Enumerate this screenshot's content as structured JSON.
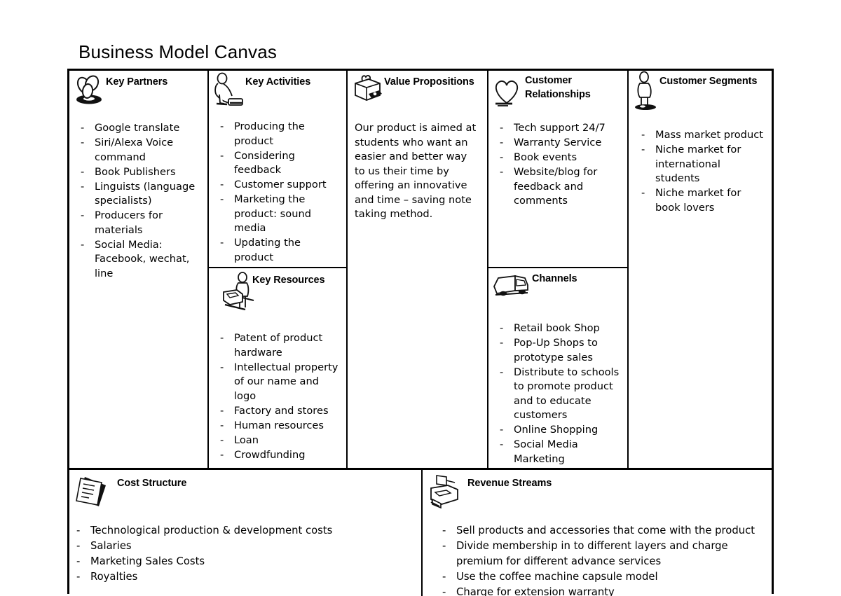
{
  "page": {
    "title": "Business Model Canvas"
  },
  "blocks": {
    "key_partners": {
      "title": "Key Partners",
      "icon": "interlocking-rings-icon",
      "items": [
        "Google translate",
        "Siri/Alexa Voice command",
        "Book Publishers",
        "Linguists (language specialists)",
        "Producers for materials",
        "Social Media: Facebook, wechat, line"
      ]
    },
    "key_activities": {
      "title": "Key Activities",
      "icon": "worker-person-icon",
      "items": [
        "Producing the product",
        "Considering feedback",
        "Customer support",
        "Marketing the product: sound media",
        "Updating the product"
      ]
    },
    "key_resources": {
      "title": "Key Resources",
      "icon": "person-with-machine-icon",
      "items": [
        "Patent of product hardware",
        "Intellectual property of our name and logo",
        "Factory and stores",
        "Human resources",
        "Loan",
        "Crowdfunding"
      ]
    },
    "value_propositions": {
      "title": "Value Propositions",
      "icon": "gift-box-icon",
      "paragraph": "Our product is aimed at students who want an easier and better way to us their time by offering an innovative and time – saving note taking method."
    },
    "customer_relationships": {
      "title": "Customer Relationships",
      "icon": "heart-icon",
      "items": [
        "Tech support 24/7",
        "Warranty Service",
        "Book events",
        "Website/blog for feedback and comments"
      ]
    },
    "channels": {
      "title": "Channels",
      "icon": "delivery-truck-icon",
      "items": [
        "Retail book Shop",
        "Pop-Up Shops to prototype sales",
        "Distribute to schools to promote product and to educate customers",
        "Online Shopping",
        "Social Media Marketing"
      ]
    },
    "customer_segments": {
      "title": "Customer Segments",
      "icon": "standing-person-icon",
      "items": [
        "Mass market product",
        "Niche market for international students",
        "Niche market for book lovers"
      ]
    },
    "cost_structure": {
      "title": "Cost Structure",
      "icon": "documents-icon",
      "items": [
        "Technological production & development costs",
        "Salaries",
        "Marketing Sales Costs",
        "Royalties"
      ]
    },
    "revenue_streams": {
      "title": "Revenue Streams",
      "icon": "cash-register-icon",
      "items": [
        "Sell products and accessories that come with the product",
        "Divide membership in to different layers and charge premium for different advance services",
        "Use the coffee machine capsule model",
        "Charge for extension warranty"
      ]
    }
  }
}
